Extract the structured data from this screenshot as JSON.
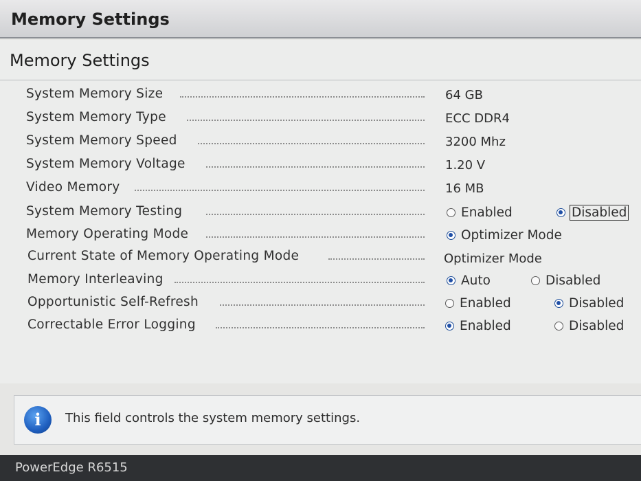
{
  "window": {
    "title": "Memory Settings"
  },
  "section": {
    "heading": "Memory Settings"
  },
  "settings": [
    {
      "label": "System Memory Size",
      "value": "64 GB"
    },
    {
      "label": "System Memory Type",
      "value": "ECC DDR4"
    },
    {
      "label": "System Memory Speed",
      "value": "3200 Mhz"
    },
    {
      "label": "System Memory Voltage",
      "value": "1.20 V"
    },
    {
      "label": "Video Memory",
      "value": "16 MB"
    },
    {
      "label": "System Memory Testing",
      "options": [
        "Enabled",
        "Disabled"
      ],
      "selected": "Disabled"
    },
    {
      "label": "Memory Operating Mode",
      "options": [
        "Optimizer Mode"
      ],
      "selected": "Optimizer Mode"
    },
    {
      "label": "Current State of Memory Operating Mode",
      "value": "Optimizer Mode"
    },
    {
      "label": "Memory Interleaving",
      "options": [
        "Auto",
        "Disabled"
      ],
      "selected": "Auto"
    },
    {
      "label": "Opportunistic Self-Refresh",
      "options": [
        "Enabled",
        "Disabled"
      ],
      "selected": "Disabled"
    },
    {
      "label": "Correctable Error Logging",
      "options": [
        "Enabled",
        "Disabled"
      ],
      "selected": "Enabled"
    }
  ],
  "help": {
    "icon": "info-icon",
    "text": "This field controls the system memory settings."
  },
  "footer": {
    "model": "PowerEdge R6515"
  },
  "colors": {
    "accent": "#1f4fa6",
    "footer_bg": "#2e3033",
    "panel_bg": "#ecedec"
  }
}
